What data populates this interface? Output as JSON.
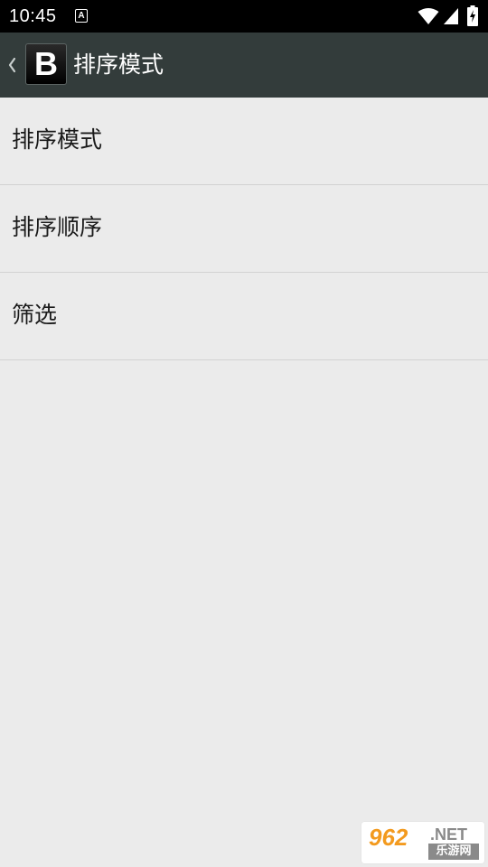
{
  "status_bar": {
    "time": "10:45",
    "notification_letter": "A",
    "icons": [
      "wifi-icon",
      "cell-signal-icon",
      "battery-charging-icon"
    ]
  },
  "action_bar": {
    "logo_letter": "B",
    "title": "排序模式",
    "icons": [
      "back-chevron-icon"
    ]
  },
  "list": {
    "items": [
      {
        "label": "排序模式"
      },
      {
        "label": "排序顺序"
      },
      {
        "label": "筛选"
      }
    ]
  },
  "watermark": {
    "brand": "962",
    "net": ".NET",
    "cn": "乐游网"
  },
  "colors": {
    "status_bar_bg": "#000000",
    "action_bar_bg": "#333c3b",
    "background": "#ebebeb",
    "divider": "#d2d2d2",
    "watermark_accent": "#f39a1e"
  }
}
